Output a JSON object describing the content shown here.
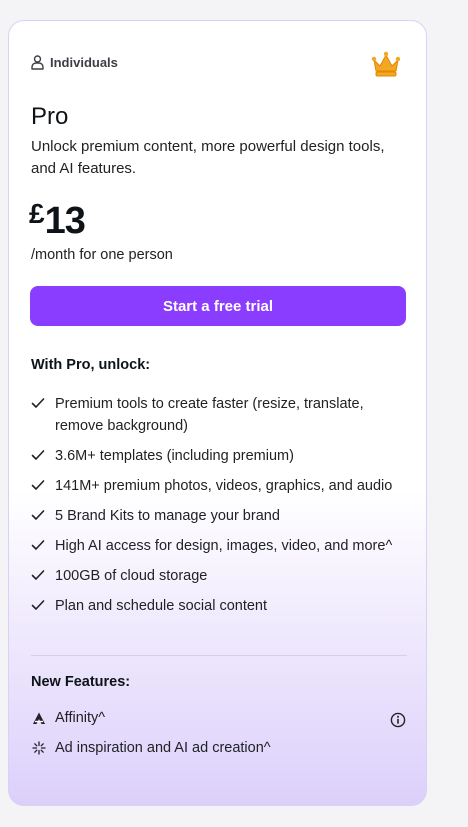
{
  "card": {
    "audience": {
      "label": "Individuals",
      "icon": "person-icon"
    },
    "badge_icon": "crown-icon",
    "plan_name": "Pro",
    "description": "Unlock premium content, more powerful design tools, and AI features.",
    "price": {
      "currency": "£",
      "amount": "13",
      "period": "/month for one person"
    },
    "cta_label": "Start a free trial",
    "features_title": "With Pro, unlock:",
    "features": [
      {
        "text": "Premium tools to create faster (resize, translate, remove background)",
        "icon": "check-icon"
      },
      {
        "text": "3.6M+ templates (including premium)",
        "icon": "check-icon"
      },
      {
        "text": "141M+ premium photos, videos, graphics, and audio",
        "icon": "check-icon"
      },
      {
        "text": "5 Brand Kits to manage your brand",
        "icon": "check-icon"
      },
      {
        "text": "High AI access for design, images, video, and more^",
        "icon": "check-icon"
      },
      {
        "text": "100GB of cloud storage",
        "icon": "check-icon"
      },
      {
        "text": "Plan and schedule social content",
        "icon": "check-icon"
      }
    ],
    "new_features_title": "New Features:",
    "new_features": [
      {
        "text": "Affinity^",
        "icon": "affinity-logo-icon",
        "info_icon": "info-icon"
      },
      {
        "text": "Ad inspiration and AI ad creation^",
        "icon": "sparkle-icon"
      }
    ]
  },
  "colors": {
    "accent": "#8b3dff",
    "crown": "#f5a623",
    "text": "#0e1318"
  }
}
